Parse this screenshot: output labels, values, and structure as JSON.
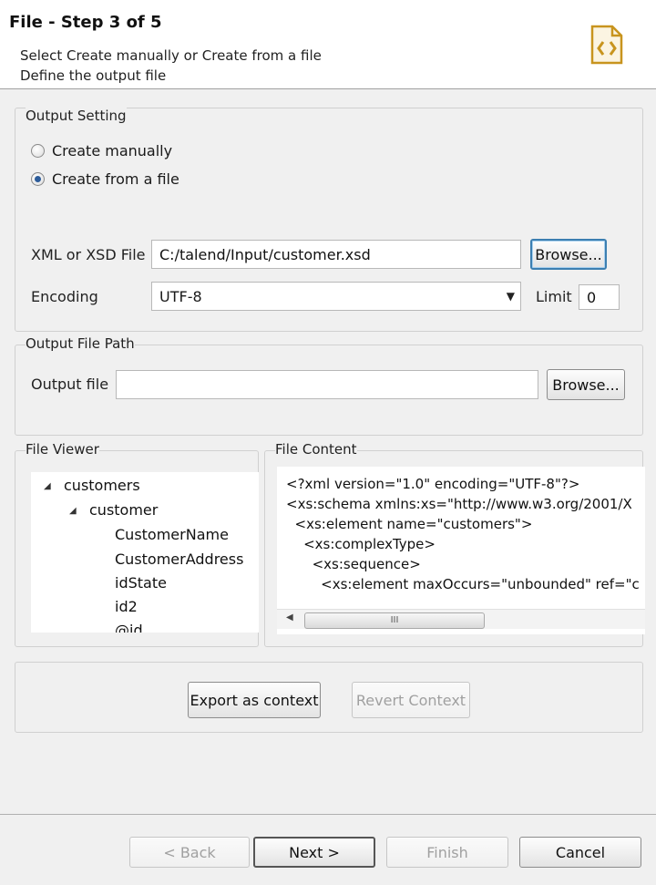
{
  "header": {
    "title": "File - Step 3 of 5",
    "desc1": "Select Create manually or Create from a file",
    "desc2": "Define the output file",
    "icon": "xml-file-icon"
  },
  "output_setting": {
    "group_label": "Output Setting",
    "radio_manual": "Create manually",
    "radio_file": "Create from a file",
    "selected": "Create from a file",
    "xml_label": "XML or XSD File",
    "xml_value": "C:/talend/Input/customer.xsd",
    "browse_label": "Browse...",
    "encoding_label": "Encoding",
    "encoding_value": "UTF-8",
    "limit_label": "Limit",
    "limit_value": "0"
  },
  "output_path": {
    "group_label": "Output File Path",
    "file_label": "Output file",
    "file_value": "",
    "browse_label": "Browse..."
  },
  "file_viewer": {
    "label": "File Viewer",
    "items": [
      "customers",
      "customer",
      "CustomerName",
      "CustomerAddress",
      "idState",
      "id2",
      "@id"
    ]
  },
  "file_content": {
    "label": "File Content",
    "lines": [
      "<?xml version=\"1.0\" encoding=\"UTF-8\"?>",
      "<xs:schema xmlns:xs=\"http://www.w3.org/2001/X",
      "  <xs:element name=\"customers\">",
      "    <xs:complexType>",
      "      <xs:sequence>",
      "        <xs:element maxOccurs=\"unbounded\" ref=\"c"
    ],
    "scroll_grip": "III"
  },
  "context": {
    "export_label": "Export as context",
    "revert_label": "Revert Context"
  },
  "footer": {
    "back_label": "< Back",
    "next_label": "Next >",
    "finish_label": "Finish",
    "cancel_label": "Cancel"
  }
}
